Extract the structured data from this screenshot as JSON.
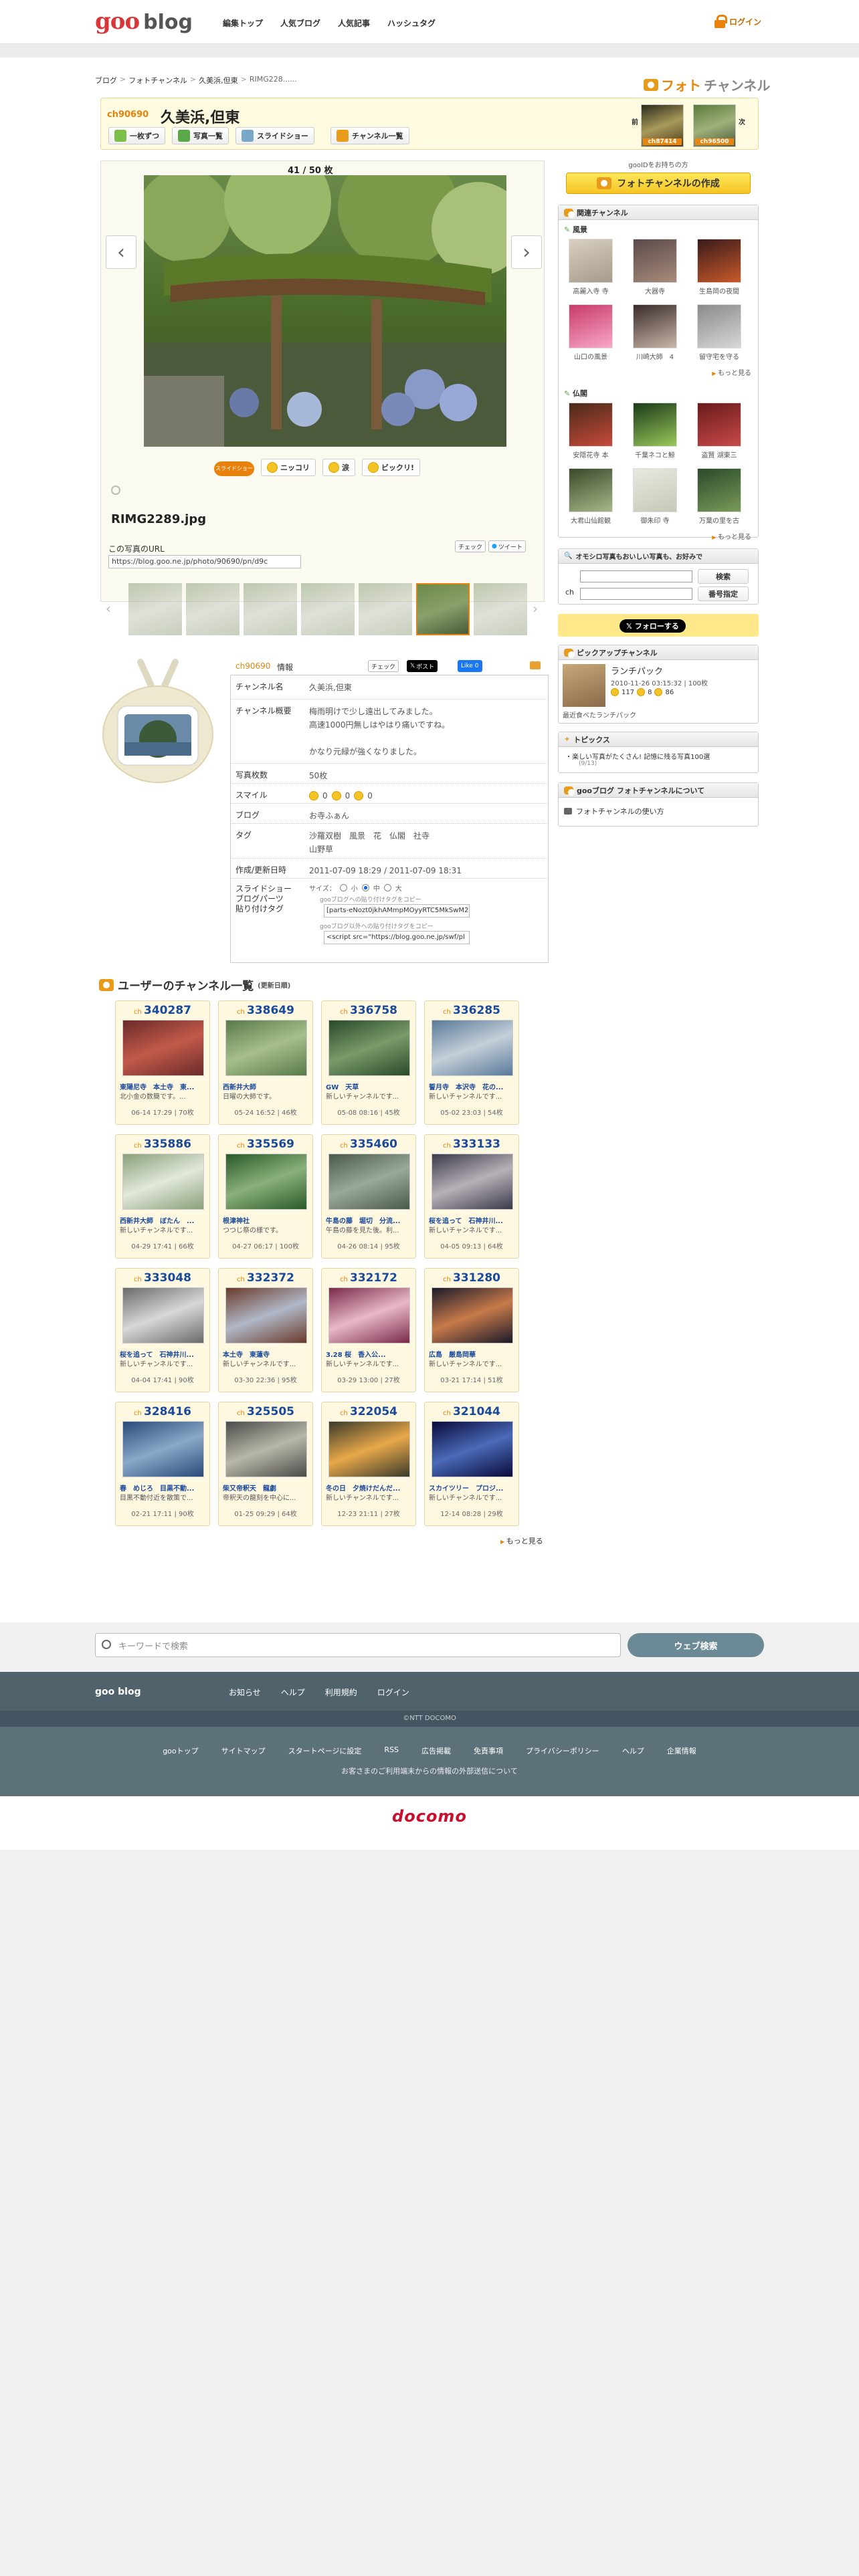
{
  "header": {
    "logo_goo": "goo",
    "logo_blog": "blog",
    "nav": [
      "編集トップ",
      "人気ブログ",
      "人気記事",
      "ハッシュタグ"
    ],
    "login": "ログイン"
  },
  "breadcrumb": [
    "ブログ",
    "フォトチャンネル",
    "久美浜,但東",
    "RIMG228......"
  ],
  "photochannel_title_a": "フォト",
  "photochannel_title_b": "チャンネル",
  "channel": {
    "id": "ch90690",
    "name": "久美浜,但東",
    "buttons": [
      "一枚ずつ",
      "写真一覧",
      "スライドショー",
      "チャンネル一覧"
    ],
    "prev_label": "前",
    "next_label": "次",
    "prev_id": "ch87414",
    "next_id": "ch96500"
  },
  "viewer": {
    "counter": "41 / 50 枚",
    "slideshow_badge": "スライドショー",
    "reactions": [
      "ニッコリ",
      "涙",
      "ビックリ!"
    ],
    "filename": "RIMG2289.jpg",
    "url_label": "この写真のURL",
    "url_value": "https://blog.goo.ne.jp/photo/90690/pn/d9c",
    "check_btn": "チェック",
    "tweet_btn": "ツイート"
  },
  "info": {
    "head_id": "ch90690",
    "head_label": "情報",
    "check": "チェック",
    "post": "ポスト",
    "like": "Like 0",
    "rows": {
      "name_k": "チャンネル名",
      "name_v": "久美浜,但東",
      "desc_k": "チャンネル概要",
      "desc_v1": "梅雨明けで少し遠出してみました。",
      "desc_v2": "高速1000円無しはやはり痛いですね。",
      "desc_v3": "かなり元緑が強くなりました。",
      "count_k": "写真枚数",
      "count_v": "50枚",
      "smile_k": "スマイル",
      "smile_a": "0",
      "smile_b": "0",
      "smile_c": "0",
      "blog_k": "ブログ",
      "blog_v": "お寺ふぁん",
      "tag_k": "タグ",
      "tag_v1": "沙羅双樹　風景　花　仏閣　社寺",
      "tag_v2": "山野草",
      "date_k": "作成/更新日時",
      "date_v": "2011-07-09 18:29 / 2011-07-09 18:31",
      "parts_k1": "スライドショー",
      "parts_k2": "ブログパーツ",
      "parts_k3": "貼り付けタグ",
      "size_label": "サイズ：",
      "size_s": "小",
      "size_m": "中",
      "size_l": "大",
      "tag1_label": "gooブログへの貼り付けタグをコピー",
      "tag1_value": "[parts-eNozt0jkhAMmpMOyyRTC5MkSwM2",
      "tag2_label": "gooブログ以外への貼り付けタグをコピー",
      "tag2_value": "<script src=\"https://blog.goo.ne.jp/swf/pl"
    }
  },
  "sidebar": {
    "login_note": "gooIDをお持ちの方",
    "create_btn": "フォトチャンネルの作成",
    "related_head": "関連チャンネル",
    "cat1": "風景",
    "cat1_items": [
      "高麗入寺 寺",
      "大器寺",
      "生島岡の夜間",
      "山口の風景",
      "川崎大師　4",
      "留守宅を守る"
    ],
    "cat2": "仏閣",
    "cat2_items": [
      "安隠花寺 本",
      "千葉ネコと鯨",
      "盗賢 湖東三",
      "大君山仙館観",
      "御朱印 寺",
      "万葉の里を古"
    ],
    "more": "もっと見る",
    "search_head": "オモシロ写真もおいしい写真も、お好みで",
    "search_btn": "検索",
    "ch_label": "ch",
    "num_btn": "番号指定",
    "follow": "フォローする",
    "pickup_head": "ピックアップチャンネル",
    "pickup_name": "ランチパック",
    "pickup_date": "2010-11-26 03:15:32 | 100枚",
    "pickup_a": "117",
    "pickup_b": "8",
    "pickup_c": "86",
    "pickup_link": "最近食べたランチパック",
    "topics_head": "トピックス",
    "topics_item": "楽しい写真がたくさん! 記憶に残る写真100選",
    "topics_date": "(9/13)",
    "about_head": "gooブログ フォトチャンネルについて",
    "about_item": "フォトチャンネルの使い方"
  },
  "users": {
    "title": "ユーザーのチャンネル一覧",
    "subtitle": "(更新日順)",
    "cards": [
      {
        "id": "340287",
        "title": "東陽尼寺　本土寺　東...",
        "desc": "北小金の数簡です。...",
        "foot": "06-14 17:29 | 70枚",
        "c1": "#6a2a2a",
        "c2": "#c25a4a"
      },
      {
        "id": "338649",
        "title": "西新井大師",
        "desc": "日曜の大師です。",
        "foot": "05-24 16:52 | 46枚",
        "c1": "#5a7a4a",
        "c2": "#a6bf8a"
      },
      {
        "id": "336758",
        "title": "GW　天草",
        "desc": "新しいチャンネルです...",
        "foot": "05-08 08:16 | 45枚",
        "c1": "#2a4a2a",
        "c2": "#7a9a6a"
      },
      {
        "id": "336285",
        "title": "誓月寺　本沢寺　花の...",
        "desc": "新しいチャンネルです...",
        "foot": "05-02 23:03 | 54枚",
        "c1": "#5a7a9a",
        "c2": "#c4cfd8"
      },
      {
        "id": "335886",
        "title": "西新井大師　ぼたん　...",
        "desc": "新しいチャンネルです...",
        "foot": "04-29 17:41 | 66枚",
        "c1": "#8aa07a",
        "c2": "#e2e8da"
      },
      {
        "id": "335569",
        "title": "根津神社",
        "desc": "つつじ祭の様です。",
        "foot": "04-27 06:17 | 100枚",
        "c1": "#2a5a2a",
        "c2": "#8ab07a"
      },
      {
        "id": "335460",
        "title": "牛島の藤　堀切　分流...",
        "desc": "午島の藤を見た後。利...",
        "foot": "04-26 08:14 | 95枚",
        "c1": "#4a5a4a",
        "c2": "#9aa89a"
      },
      {
        "id": "333133",
        "title": "桜を追って　石神井川...",
        "desc": "新しいチャンネルです...",
        "foot": "04-05 09:13 | 64枚",
        "c1": "#3a3a4a",
        "c2": "#b8b0b8"
      },
      {
        "id": "333048",
        "title": "桜を追って　石神井川...",
        "desc": "新しいチャンネルです...",
        "foot": "04-04 17:41 | 90枚",
        "c1": "#6a6a6a",
        "c2": "#d8d8d8"
      },
      {
        "id": "332372",
        "title": "本土寺　東蓮寺",
        "desc": "新しいチャンネルです...",
        "foot": "03-30 22:36 | 95枚",
        "c1": "#6a3a2a",
        "c2": "#b0b8c8"
      },
      {
        "id": "332172",
        "title": "3.28 桜　香入公...",
        "desc": "新しいチャンネルです...",
        "foot": "03-29 13:00 | 27枚",
        "c1": "#7a2a4a",
        "c2": "#e8b8c8"
      },
      {
        "id": "331280",
        "title": "広島　厳島岡華",
        "desc": "新しいチャンネルです...",
        "foot": "03-21 17:14 | 51枚",
        "c1": "#1a1a2a",
        "c2": "#c87a4a"
      },
      {
        "id": "328416",
        "title": "春　めじろ　目黒不動...",
        "desc": "目黒不動付近を散策で...",
        "foot": "02-21 17:11 | 90枚",
        "c1": "#2a4a7a",
        "c2": "#8aa8c8"
      },
      {
        "id": "325505",
        "title": "柴又帝釈天　龍劇",
        "desc": "帝釈天の龍刻を中心に...",
        "foot": "01-25 09:29 | 64枚",
        "c1": "#4a4a4a",
        "c2": "#b8b8a8"
      },
      {
        "id": "322054",
        "title": "冬の日　夕焼けだんだ...",
        "desc": "新しいチャンネルです...",
        "foot": "12-23 21:11 | 27枚",
        "c1": "#3a3a2a",
        "c2": "#e8a84a"
      },
      {
        "id": "321044",
        "title": "スカイツリー　プロジ...",
        "desc": "新しいチャンネルです...",
        "foot": "12-14 08:28 | 29枚",
        "c1": "#0a0a3a",
        "c2": "#4a6ab8"
      }
    ],
    "more": "もっと見る"
  },
  "search": {
    "placeholder": "キーワードで検索",
    "button": "ウェブ検索"
  },
  "footer": {
    "logo": "goo blog",
    "nav": [
      "お知らせ",
      "ヘルプ",
      "利用規約",
      "ログイン"
    ],
    "copyright": "©NTT DOCOMO",
    "nav2": [
      "gooトップ",
      "サイトマップ",
      "スタートページに設定",
      "RSS",
      "広告掲載",
      "免責事項",
      "プライバシーポリシー",
      "ヘルプ",
      "企業情報"
    ],
    "note": "お客さまのご利用端末からの情報の外部送信について",
    "brand": "docomo"
  }
}
